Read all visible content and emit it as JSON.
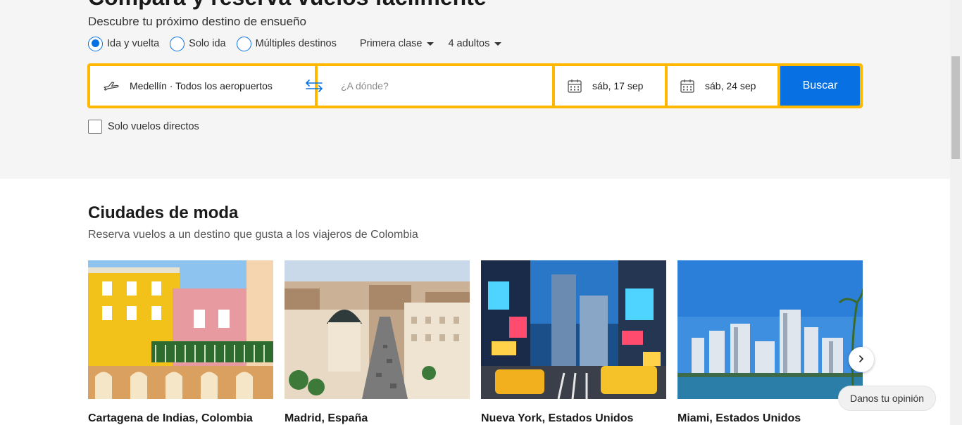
{
  "hero": {
    "title": "Compara y reserva vuelos fácilmente",
    "subtitle": "Descubre tu próximo destino de ensueño",
    "trip_types": [
      {
        "label": "Ida y vuelta",
        "checked": true
      },
      {
        "label": "Solo ida",
        "checked": false
      },
      {
        "label": "Múltiples destinos",
        "checked": false
      }
    ],
    "cabin_class": "Primera clase",
    "passengers": "4 adultos"
  },
  "search": {
    "origin": "Medellín · Todos los aeropuertos",
    "destination_placeholder": "¿A dónde?",
    "depart_date": "sáb, 17 sep",
    "return_date": "sáb, 24 sep",
    "search_label": "Buscar",
    "direct_only_label": "Solo vuelos directos",
    "direct_only_checked": false
  },
  "trending": {
    "title": "Ciudades de moda",
    "subtitle": "Reserva vuelos a un destino que gusta a los viajeros de Colombia",
    "cities": [
      {
        "name": "Cartagena de Indias, Colombia"
      },
      {
        "name": "Madrid, España"
      },
      {
        "name": "Nueva York, Estados Unidos"
      },
      {
        "name": "Miami, Estados Unidos"
      }
    ]
  },
  "feedback_label": "Danos tu opinión",
  "colors": {
    "accent_blue": "#0770e3",
    "search_border_yellow": "#ffb700",
    "hero_background": "#f5f5f5"
  },
  "icons": [
    "plane-icon",
    "swap-icon",
    "calendar-icon",
    "chevron-right-icon"
  ]
}
